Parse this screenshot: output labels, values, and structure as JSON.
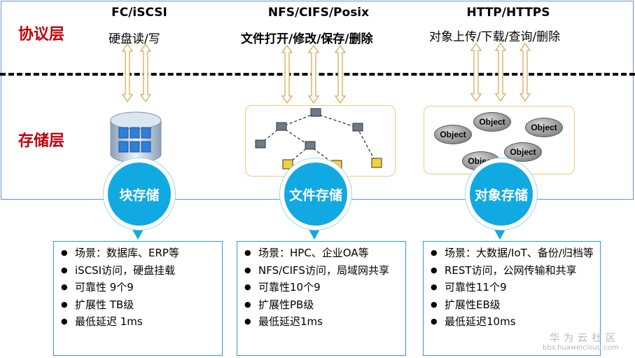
{
  "layers": {
    "protocol": "协议层",
    "storage": "存储层"
  },
  "columns": [
    {
      "protocol_title": "FC/iSCSI",
      "protocol_ops": "硬盘读/写",
      "badge": "块存储",
      "features": [
        "场景：数据库、ERP等",
        "iSCSI访问，硬盘挂载",
        "可靠性 9个9",
        "扩展性 TB级",
        "最低延迟 1ms"
      ]
    },
    {
      "protocol_title": "NFS/CIFS/Posix",
      "protocol_ops": "文件打开/修改/保存/删除",
      "badge": "文件存储",
      "features": [
        "场景：HPC、企业OA等",
        "NFS/CIFS访问，局域网共享",
        "可靠性10个9",
        "扩展性PB级",
        "最低延迟1ms"
      ]
    },
    {
      "protocol_title": "HTTP/HTTPS",
      "protocol_ops": "对象上传/下载/查询/删除",
      "badge": "对象存储",
      "features": [
        "场景：大数据/IoT、备份/归档等",
        "REST访问，公网传输和共享",
        "可靠性11个9",
        "扩展性EB级",
        "最低延迟10ms"
      ]
    }
  ],
  "object_labels": [
    "Object",
    "Object",
    "Object",
    "Object",
    "Object"
  ],
  "watermark": {
    "brand": "华为云社区",
    "url": "bbs.huaweicloud.com"
  },
  "colors": {
    "layer_label": "#c0000c",
    "badge": "#11a9e2",
    "arrow": "#d9a95a",
    "info_border": "#2aa1d4"
  }
}
